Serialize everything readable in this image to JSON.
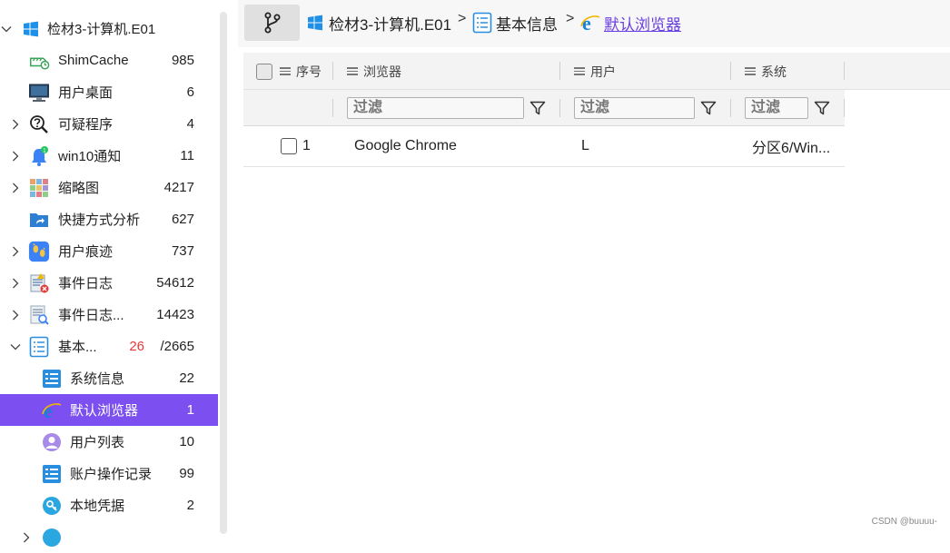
{
  "sidebar": {
    "items": [
      {
        "label": "检材3-计算机.E01",
        "count": "",
        "icon": "windows-logo-icon",
        "level": 0,
        "expander": "expanded"
      },
      {
        "label": "ShimCache",
        "count": "985",
        "icon": "shimcache-icon",
        "level": 1,
        "expander": "none"
      },
      {
        "label": "用户桌面",
        "count": "6",
        "icon": "desktop-monitor-icon",
        "level": 1,
        "expander": "none"
      },
      {
        "label": "可疑程序",
        "count": "4",
        "icon": "magnifier-question-icon",
        "level": 1,
        "expander": "collapsed"
      },
      {
        "label": "win10通知",
        "count": "11",
        "icon": "bell-notification-icon",
        "level": 1,
        "expander": "collapsed"
      },
      {
        "label": "缩略图",
        "count": "4217",
        "icon": "thumbnail-grid-icon",
        "level": 1,
        "expander": "collapsed"
      },
      {
        "label": "快捷方式分析",
        "count": "627",
        "icon": "shortcut-folder-icon",
        "level": 1,
        "expander": "none"
      },
      {
        "label": "用户痕迹",
        "count": "737",
        "icon": "footprints-icon",
        "level": 1,
        "expander": "collapsed"
      },
      {
        "label": "事件日志",
        "count": "54612",
        "icon": "event-log-error-icon",
        "level": 1,
        "expander": "collapsed"
      },
      {
        "label": "事件日志...",
        "count": "14423",
        "icon": "event-log-search-icon",
        "level": 1,
        "expander": "collapsed"
      },
      {
        "label": "基本...",
        "count": "/2665",
        "count_highlight": "26",
        "icon": "list-document-icon",
        "level": 1,
        "expander": "expanded"
      },
      {
        "label": "系统信息",
        "count": "22",
        "icon": "system-info-icon",
        "level": 2,
        "expander": "none"
      },
      {
        "label": "默认浏览器",
        "count": "1",
        "icon": "ie-browser-icon",
        "level": 2,
        "expander": "none",
        "selected": true
      },
      {
        "label": "用户列表",
        "count": "10",
        "icon": "user-avatar-icon",
        "level": 2,
        "expander": "none"
      },
      {
        "label": "账户操作记录",
        "count": "99",
        "icon": "account-log-icon",
        "level": 2,
        "expander": "none"
      },
      {
        "label": "本地凭据",
        "count": "2",
        "icon": "key-credential-icon",
        "level": 2,
        "expander": "none"
      },
      {
        "label": "",
        "count": "",
        "icon": "partial-item-icon",
        "level": 2,
        "expander": "collapsed"
      }
    ]
  },
  "breadcrumb": {
    "items": [
      {
        "label": "检材3-计算机.E01",
        "icon": "windows-logo-icon"
      },
      {
        "label": "基本信息",
        "icon": "list-document-icon"
      },
      {
        "label": "默认浏览器",
        "icon": "ie-browser-icon",
        "link": true
      }
    ],
    "separator": ">"
  },
  "table": {
    "columns": [
      {
        "label": "序号"
      },
      {
        "label": "浏览器"
      },
      {
        "label": "用户"
      },
      {
        "label": "系统"
      }
    ],
    "filter_placeholder": "过滤",
    "rows": [
      {
        "index": "1",
        "browser": "Google Chrome",
        "user": "L",
        "system": "分区6/Win..."
      }
    ]
  },
  "watermark": "CSDN @buuuu-",
  "colors": {
    "accent": "#7b4ff0",
    "count_highlight": "#e53935",
    "link": "#6a3fe0"
  }
}
